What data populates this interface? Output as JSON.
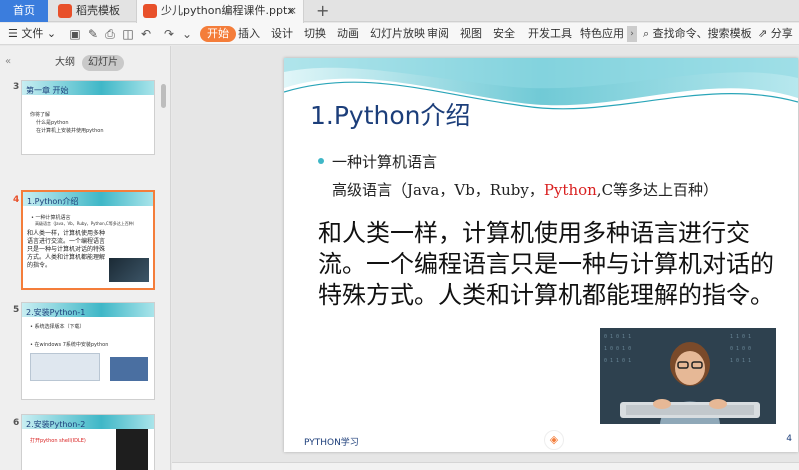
{
  "tabs": {
    "home": "首页",
    "items": [
      {
        "label": "稻壳模板"
      },
      {
        "label": "少儿python编程课件.pptx"
      }
    ],
    "close": "×",
    "add": "+"
  },
  "toolbar": {
    "file_menu": "文件",
    "start": "开始",
    "items": [
      "插入",
      "设计",
      "切换",
      "动画",
      "幻灯片放映",
      "审阅",
      "视图",
      "安全",
      "开发工具",
      "特色应用"
    ],
    "search": "查找命令、搜索模板",
    "share": "分享"
  },
  "left_panel": {
    "outline_tab": "大纲",
    "slides_tab": "幻灯片",
    "slides": [
      {
        "number": "3",
        "title": "第一章 开始",
        "lines": [
          "你将了解",
          "什么是python",
          "在计算机上安装并使用python"
        ]
      },
      {
        "number": "4",
        "title": "1.Python介绍",
        "lines": [
          "• 一种计算机语言",
          "高级语言（Java，Vb，Ruby，Python,C等多达上百种）"
        ],
        "body": "和人类一样，计算机使用多种语言进行交流。一个编程语言只是一种与计算机对话的特殊方式。人类和计算机都能理解的指令。"
      },
      {
        "number": "5",
        "title": "2.安装Python-1",
        "lines": [
          "• 系统选择版本（下载）",
          "• 在windows 7系统中安装python"
        ]
      },
      {
        "number": "6",
        "title": "2.安装Python-2",
        "lines": [
          "打开python shell(IDLE)"
        ]
      }
    ]
  },
  "slide": {
    "title": "1.Python介绍",
    "bullet": "一种计算机语言",
    "sub_prefix": "高级语言（Java，Vb，Ruby，",
    "sub_highlight": "Python",
    "sub_suffix": ",C等多达上百种）",
    "body": "和人类一样，计算机使用多种语言进行交流。一个编程语言只是一种与计算机对话的特殊方式。人类和计算机都能理解的指令。",
    "footer": "PYTHON学习",
    "page_number": "4"
  },
  "colors": {
    "accent": "#f47d3a",
    "home_tab": "#3b7ddd",
    "title": "#1c3e7a",
    "wave": "#3fb7c7",
    "highlight": "#d92020"
  }
}
